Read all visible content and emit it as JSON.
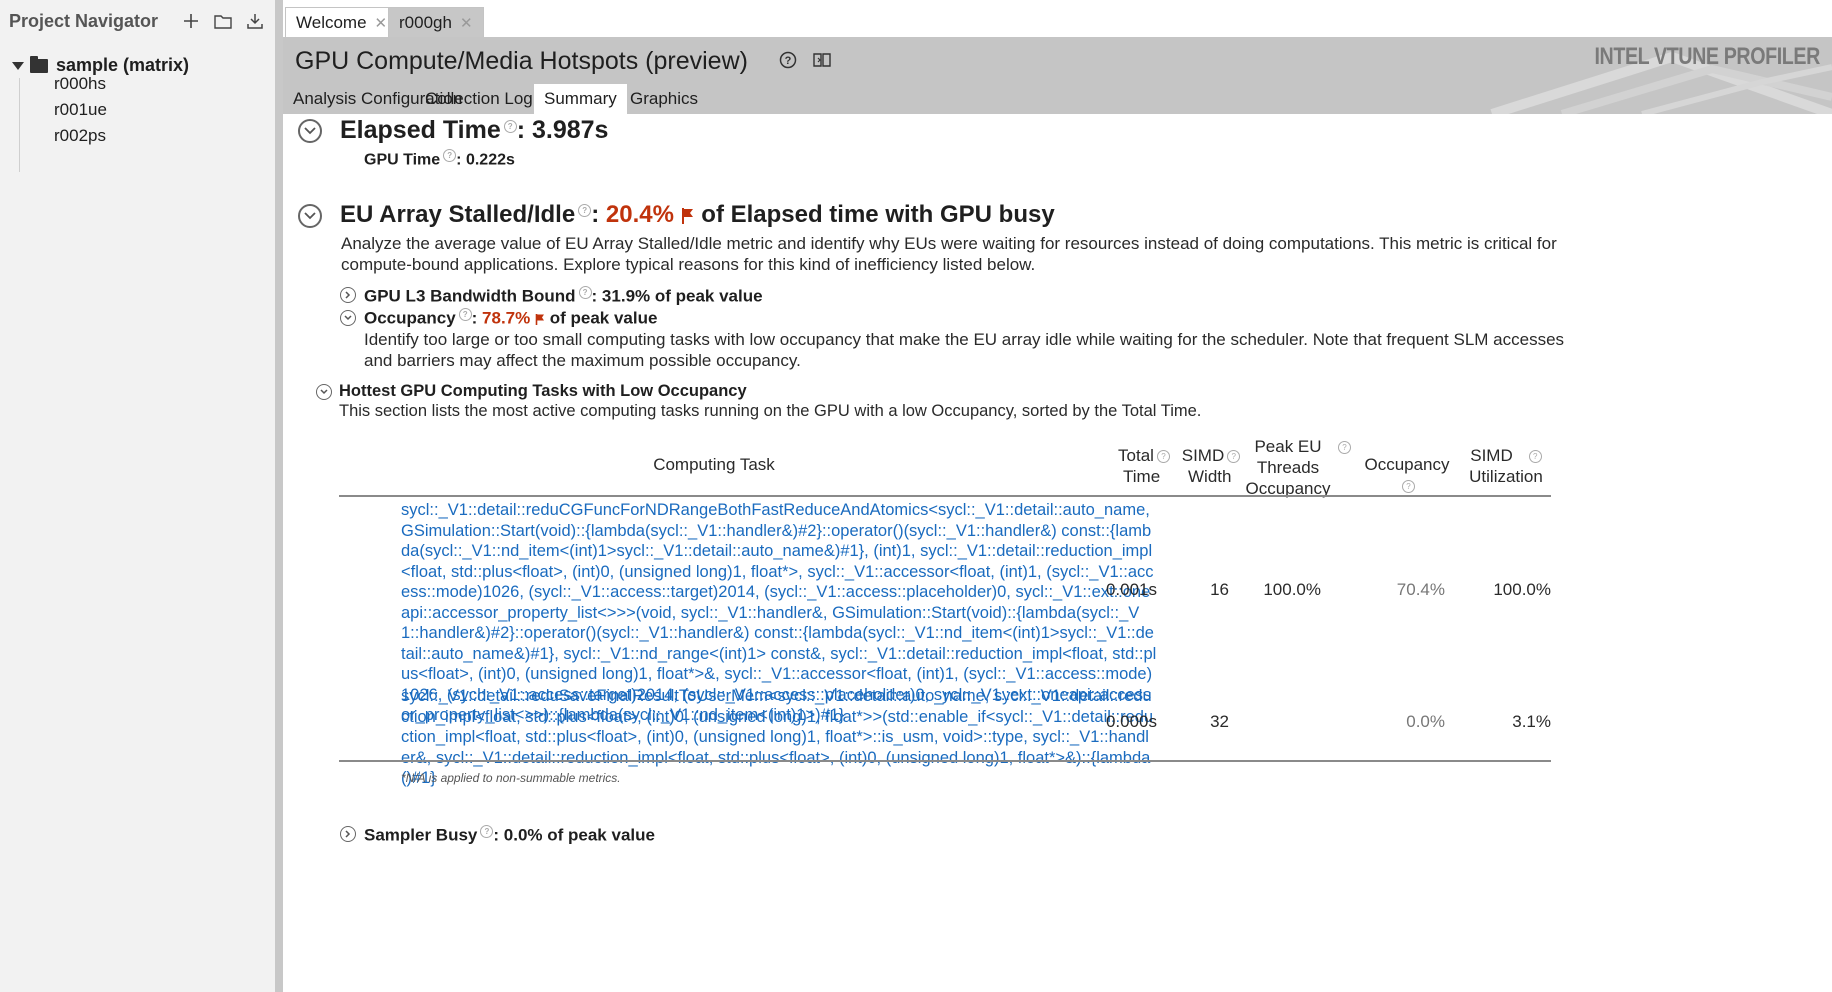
{
  "sidebar": {
    "title": "Project Navigator",
    "tools": [
      "plus-icon",
      "folder-icon",
      "download-icon"
    ],
    "root": "sample (matrix)",
    "items": [
      "r000hs",
      "r001ue",
      "r002ps"
    ]
  },
  "tabs": [
    {
      "label": "Welcome",
      "active": false
    },
    {
      "label": "r000gh",
      "active": true
    }
  ],
  "header": {
    "title": "GPU Compute/Media Hotspots (preview)",
    "brand": "INTEL VTUNE PROFILER",
    "subtabs": [
      "Analysis Configuration",
      "Collection Log",
      "Summary",
      "Graphics"
    ],
    "active_subtab": "Summary"
  },
  "summary": {
    "elapsed": {
      "label": "Elapsed Time",
      "value": ": 3.987s"
    },
    "gpu_time": {
      "label": "GPU Time",
      "value": ": 0.222s"
    },
    "eu": {
      "label": "EU Array Stalled/Idle",
      "sep": ": ",
      "value": "20.4%",
      "suffix": "of Elapsed time with GPU busy",
      "description": "Analyze the average value of EU Array Stalled/Idle metric and identify why EUs were waiting for resources instead of doing computations. This metric is critical for compute-bound applications. Explore typical reasons for this kind of inefficiency listed below."
    },
    "l3": {
      "label": "GPU L3 Bandwidth Bound",
      "value": ": 31.9% of peak value"
    },
    "occupancy": {
      "label": "Occupancy",
      "sep": ": ",
      "value": "78.7%",
      "suffix": "of peak value",
      "description": "Identify too large or too small computing tasks with low occupancy that make the EU array idle while waiting for the scheduler. Note that frequent SLM accesses and barriers may affect the maximum possible occupancy."
    },
    "hottest": {
      "title": "Hottest GPU Computing Tasks with Low Occupancy",
      "description": "This section lists the most active computing tasks running on the GPU with a low Occupancy, sorted by the Total Time."
    },
    "table": {
      "columns": {
        "task": "Computing Task",
        "total_time": [
          "Total",
          "Time"
        ],
        "simd_width": [
          "SIMD",
          "Width"
        ],
        "peak_eu": [
          "Peak EU",
          "Threads",
          "Occupancy"
        ],
        "occupancy": "Occupancy",
        "simd_util": [
          "SIMD",
          "Utilization"
        ]
      },
      "rows": [
        {
          "task": "sycl::_V1::detail::reduCGFuncForNDRangeBothFastReduceAndAtomics<sycl::_V1::detail::auto_name, GSimulation::Start(void)::{lambda(sycl::_V1::handler&)#2}::operator()(sycl::_V1::handler&) const::{lambda(sycl::_V1::nd_item<(int)1>sycl::_V1::detail::auto_name&)#1}, (int)1, sycl::_V1::detail::reduction_impl<float, std::plus<float>, (int)0, (unsigned long)1, float*>, sycl::_V1::accessor<float, (int)1, (sycl::_V1::access::mode)1026, (sycl::_V1::access::target)2014, (sycl::_V1::access::placeholder)0, sycl::_V1::ext::oneapi::accessor_property_list<>>>(void, sycl::_V1::handler&, GSimulation::Start(void)::{lambda(sycl::_V1::handler&)#2}::operator()(sycl::_V1::handler&) const::{lambda(sycl::_V1::nd_item<(int)1>sycl::_V1::detail::auto_name&)#1}, sycl::_V1::nd_range<(int)1> const&, sycl::_V1::detail::reduction_impl<float, std::plus<float>, (int)0, (unsigned long)1, float*>&, sycl::_V1::accessor<float, (int)1, (sycl::_V1::access::mode)1026, (sycl::_V1::access::target)2014, (sycl::_V1::access::placeholder)0, sycl::_V1::ext::oneapi::accessor_property_list<>>)::{lambda(sycl::_V1::nd_item<(int)1>)#1}",
          "total_time": "0.001s",
          "simd_width": "16",
          "peak_eu": "100.0%",
          "occupancy": "70.4%",
          "simd_util": "100.0%"
        },
        {
          "task": "sycl::_V1::detail::reduSaveFinalResultToUserMem<sycl::_V1::detail::auto_name, sycl::_V1::detail::reduction_impl<float, std::plus<float>, (int)0, (unsigned long)1, float*>>(std::enable_if<sycl::_V1::detail::reduction_impl<float, std::plus<float>, (int)0, (unsigned long)1, float*>::is_usm, void>::type, sycl::_V1::handler&, sycl::_V1::detail::reduction_impl<float, std::plus<float>, (int)0, (unsigned long)1, float*>&)::{lambda()#1}",
          "total_time": "0.000s",
          "simd_width": "32",
          "peak_eu": "",
          "occupancy": "0.0%",
          "simd_util": "3.1%"
        }
      ],
      "note": "*N/A is applied to non-summable metrics."
    },
    "sampler": {
      "label": "Sampler Busy",
      "value": ": 0.0% of peak value"
    }
  },
  "colors": {
    "accent_red": "#c0330c",
    "link_blue": "#1a6bbf",
    "header_gray": "#c5c5c5"
  }
}
